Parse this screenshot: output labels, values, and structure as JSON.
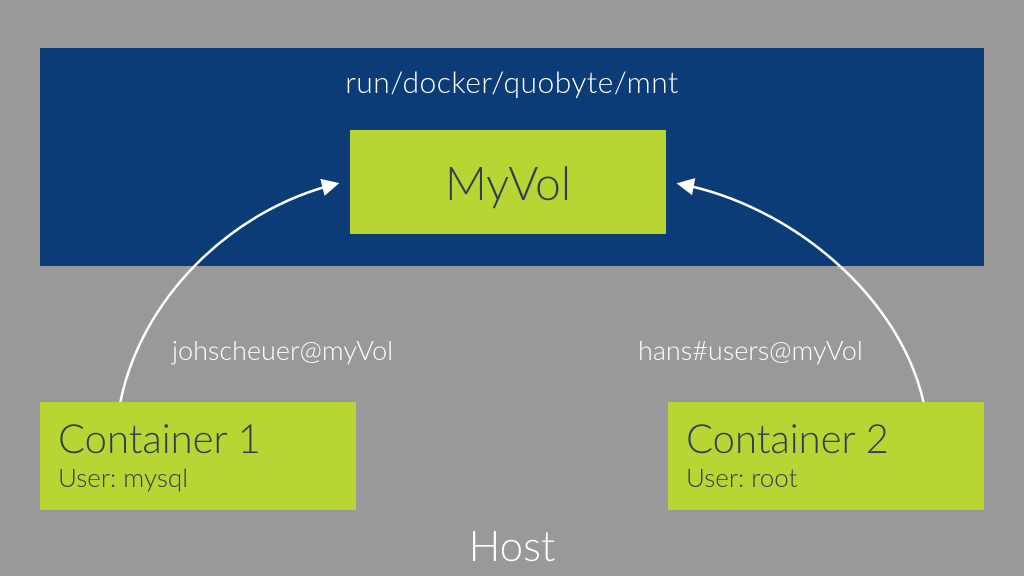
{
  "mount_path": "run/docker/quobyte/mnt",
  "volume": {
    "label": "MyVol"
  },
  "edges": {
    "left": {
      "label": "johscheuer@myVol"
    },
    "right": {
      "label": "hans#users@myVol"
    }
  },
  "containers": {
    "left": {
      "title": "Container 1",
      "user_line": "User: mysql"
    },
    "right": {
      "title": "Container 2",
      "user_line": "User: root"
    }
  },
  "host_label": "Host",
  "colors": {
    "background": "#999999",
    "band": "#0b3c78",
    "accent": "#b7d633",
    "text_on_accent": "#2c3e50",
    "text_on_band": "#ffffff"
  }
}
